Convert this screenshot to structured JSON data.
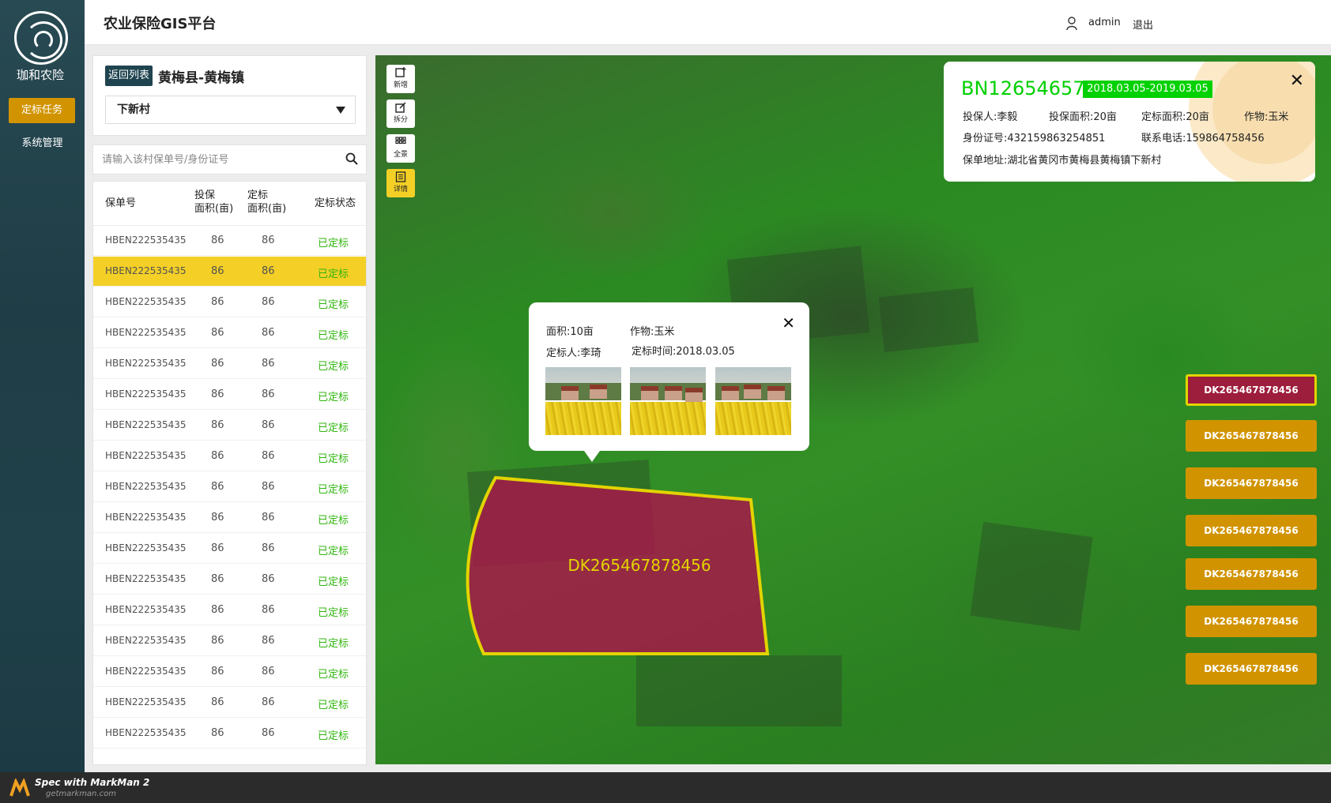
{
  "app": {
    "brand": "珈和农险",
    "title": "农业保险GIS平台"
  },
  "nav": {
    "items": [
      {
        "label": "定标任务",
        "active": true
      },
      {
        "label": "系统管理",
        "active": false
      }
    ]
  },
  "header": {
    "user": "admin",
    "logout": "退出"
  },
  "region": {
    "back_label": "返回列表",
    "place": "黄梅县-黄梅镇",
    "village": "下新村"
  },
  "search": {
    "placeholder": "请输入该村保单号/身份证号"
  },
  "table": {
    "headers": [
      "保单号",
      "投保面积(亩)",
      "定标面积(亩)",
      "定标状态"
    ],
    "header_lines": [
      [
        "保单号"
      ],
      [
        "投保",
        "面积(亩)"
      ],
      [
        "定标",
        "面积(亩)"
      ],
      [
        "定标状态"
      ]
    ],
    "rows": [
      {
        "policy": "HBEN222535435",
        "insured": "86",
        "calibrated": "86",
        "status": "已定标"
      },
      {
        "policy": "HBEN222535435",
        "insured": "86",
        "calibrated": "86",
        "status": "已定标",
        "selected": true
      },
      {
        "policy": "HBEN222535435",
        "insured": "86",
        "calibrated": "86",
        "status": "已定标"
      },
      {
        "policy": "HBEN222535435",
        "insured": "86",
        "calibrated": "86",
        "status": "已定标"
      },
      {
        "policy": "HBEN222535435",
        "insured": "86",
        "calibrated": "86",
        "status": "已定标"
      },
      {
        "policy": "HBEN222535435",
        "insured": "86",
        "calibrated": "86",
        "status": "已定标"
      },
      {
        "policy": "HBEN222535435",
        "insured": "86",
        "calibrated": "86",
        "status": "已定标"
      },
      {
        "policy": "HBEN222535435",
        "insured": "86",
        "calibrated": "86",
        "status": "已定标"
      },
      {
        "policy": "HBEN222535435",
        "insured": "86",
        "calibrated": "86",
        "status": "已定标"
      },
      {
        "policy": "HBEN222535435",
        "insured": "86",
        "calibrated": "86",
        "status": "已定标"
      },
      {
        "policy": "HBEN222535435",
        "insured": "86",
        "calibrated": "86",
        "status": "已定标"
      },
      {
        "policy": "HBEN222535435",
        "insured": "86",
        "calibrated": "86",
        "status": "已定标"
      },
      {
        "policy": "HBEN222535435",
        "insured": "86",
        "calibrated": "86",
        "status": "已定标"
      },
      {
        "policy": "HBEN222535435",
        "insured": "86",
        "calibrated": "86",
        "status": "已定标"
      },
      {
        "policy": "HBEN222535435",
        "insured": "86",
        "calibrated": "86",
        "status": "已定标"
      },
      {
        "policy": "HBEN222535435",
        "insured": "86",
        "calibrated": "86",
        "status": "已定标"
      },
      {
        "policy": "HBEN222535435",
        "insured": "86",
        "calibrated": "86",
        "status": "已定标"
      }
    ]
  },
  "tools": [
    {
      "label": "新增",
      "icon": "add-plot-icon"
    },
    {
      "label": "拆分",
      "icon": "split-icon"
    },
    {
      "label": "全景",
      "icon": "grid-icon"
    },
    {
      "label": "详情",
      "icon": "details-icon",
      "active": true
    }
  ],
  "parcel": {
    "label": "DK265467878456"
  },
  "popup": {
    "area": "面积:10亩",
    "crop": "作物:玉米",
    "surveyor": "定标人:李琦",
    "time": "定标时间:2018.03.05"
  },
  "info": {
    "policy_no": "BN12654657",
    "period": "2018.03.05-2019.03.05",
    "insured_person": "投保人:李毅",
    "insured_area": "投保面积:20亩",
    "calibrated_area": "定标面积:20亩",
    "crop": "作物:玉米",
    "id_number": "身份证号:432159863254851",
    "phone": "联系电话:159864758456",
    "address": "保单地址:湖北省黄冈市黄梅县黄梅镇下新村"
  },
  "plots": [
    {
      "label": "DK265467878456",
      "active": true
    },
    {
      "label": "DK265467878456"
    },
    {
      "label": "DK265467878456"
    },
    {
      "label": "DK265467878456"
    },
    {
      "label": "DK265467878456"
    },
    {
      "label": "DK265467878456"
    },
    {
      "label": "DK265467878456"
    }
  ],
  "footer": {
    "title": "Spec with MarkMan 2",
    "url": "getmarkman.com"
  },
  "colors": {
    "nav_bg": "#1f444f",
    "accent": "#d19400",
    "status_green": "#30b60e",
    "policy_green": "#00d000",
    "period_green": "#00d100",
    "plot_outline": "#e2d400",
    "text_dark": "#515151",
    "placeholder": "#878787"
  }
}
